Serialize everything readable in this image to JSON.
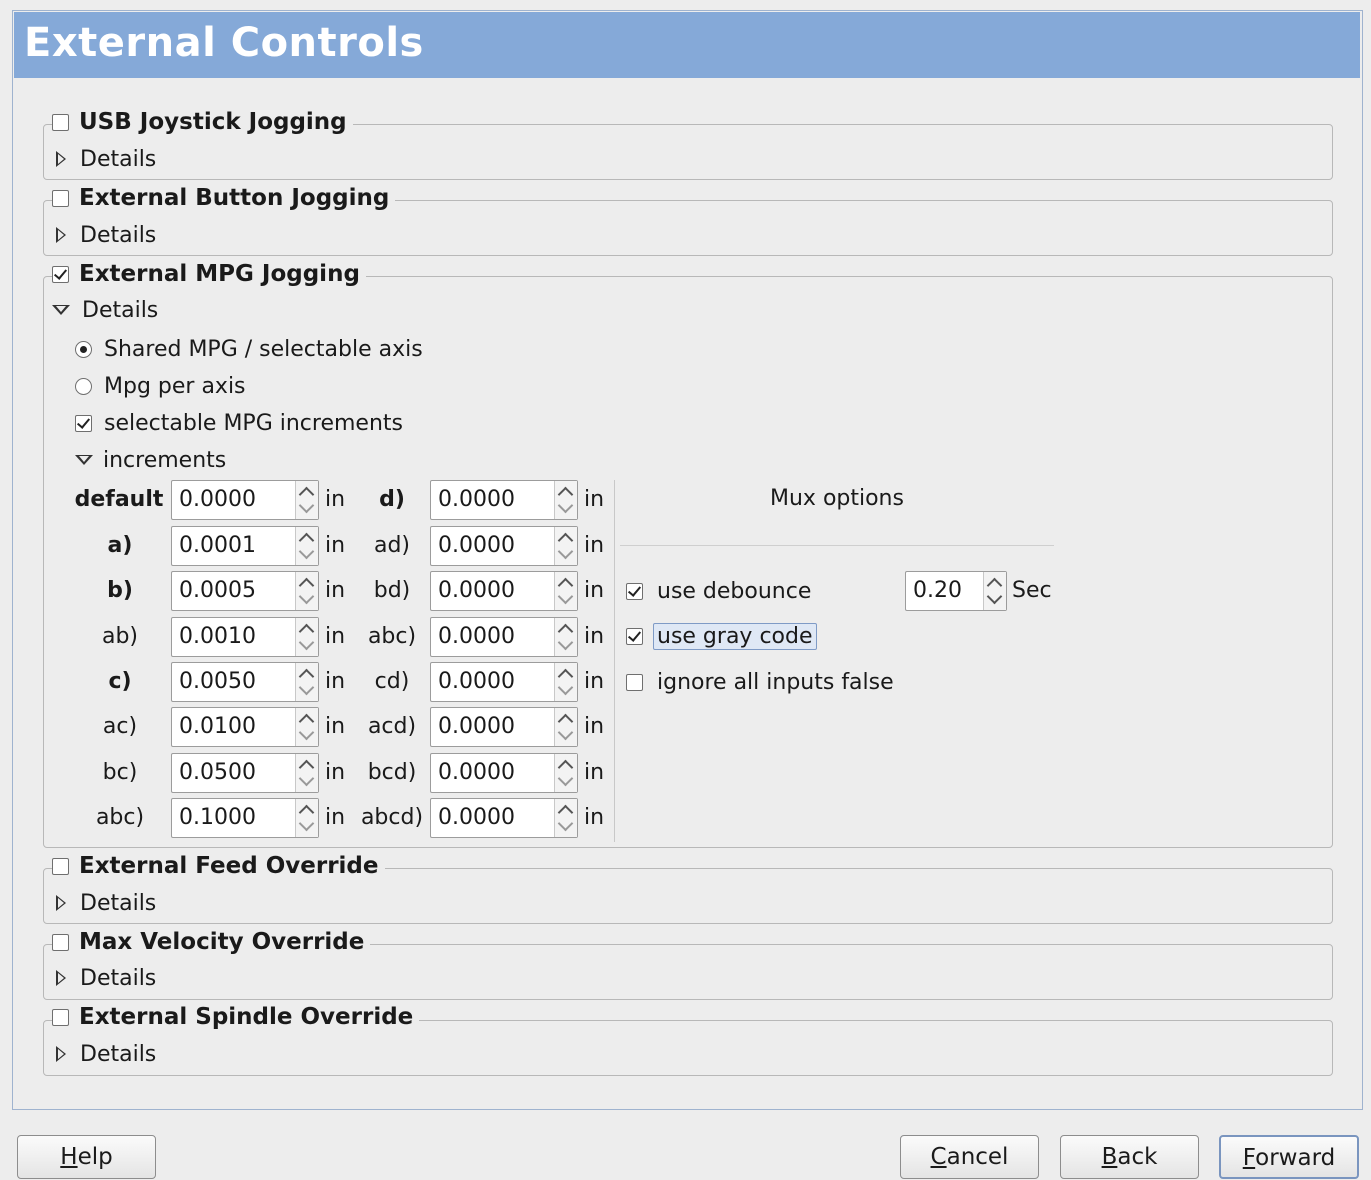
{
  "header": {
    "title": "External Controls"
  },
  "sections": [
    {
      "id": "usb",
      "label": "USB Joystick Jogging",
      "checked": false,
      "details_label": "Details",
      "expanded": false
    },
    {
      "id": "button",
      "label": "External Button Jogging",
      "checked": false,
      "details_label": "Details",
      "expanded": false
    },
    {
      "id": "mpg",
      "label": "External MPG Jogging",
      "checked": true,
      "details_label": "Details",
      "expanded": true
    },
    {
      "id": "feed",
      "label": "External Feed Override",
      "checked": false,
      "details_label": "Details",
      "expanded": false
    },
    {
      "id": "maxvel",
      "label": "Max Velocity Override",
      "checked": false,
      "details_label": "Details",
      "expanded": false
    },
    {
      "id": "spindle",
      "label": "External Spindle Override",
      "checked": false,
      "details_label": "Details",
      "expanded": false
    }
  ],
  "mpg": {
    "shared_label": "Shared MPG / selectable axis",
    "per_axis_label": "Mpg per axis",
    "selectable_label": "selectable MPG increments",
    "increments_label": "increments",
    "left_rows": [
      {
        "label": "default",
        "value": "0.0000",
        "unit": "in"
      },
      {
        "label": "a)",
        "value": "0.0001",
        "unit": "in"
      },
      {
        "label": "b)",
        "value": "0.0005",
        "unit": "in"
      },
      {
        "label": "ab)",
        "value": "0.0010",
        "unit": "in"
      },
      {
        "label": "c)",
        "value": "0.0050",
        "unit": "in"
      },
      {
        "label": "ac)",
        "value": "0.0100",
        "unit": "in"
      },
      {
        "label": "bc)",
        "value": "0.0500",
        "unit": "in"
      },
      {
        "label": "abc)",
        "value": "0.1000",
        "unit": "in"
      }
    ],
    "right_rows": [
      {
        "label": "d)",
        "value": "0.0000",
        "unit": "in"
      },
      {
        "label": "ad)",
        "value": "0.0000",
        "unit": "in"
      },
      {
        "label": "bd)",
        "value": "0.0000",
        "unit": "in"
      },
      {
        "label": "abc)",
        "value": "0.0000",
        "unit": "in"
      },
      {
        "label": "cd)",
        "value": "0.0000",
        "unit": "in"
      },
      {
        "label": "acd)",
        "value": "0.0000",
        "unit": "in"
      },
      {
        "label": "bcd)",
        "value": "0.0000",
        "unit": "in"
      },
      {
        "label": "abcd)",
        "value": "0.0000",
        "unit": "in"
      }
    ],
    "mux": {
      "title": "Mux options",
      "debounce_label": "use debounce",
      "debounce_value": "0.20",
      "debounce_unit": "Sec",
      "gray_label": "use gray code",
      "ignore_label": "ignore all inputs false"
    }
  },
  "buttons": {
    "help_m": "H",
    "help_r": "elp",
    "cancel_m": "C",
    "cancel_r": "ancel",
    "back_m": "B",
    "back_r": "ack",
    "forward_m": "F",
    "forward_r": "orward"
  }
}
